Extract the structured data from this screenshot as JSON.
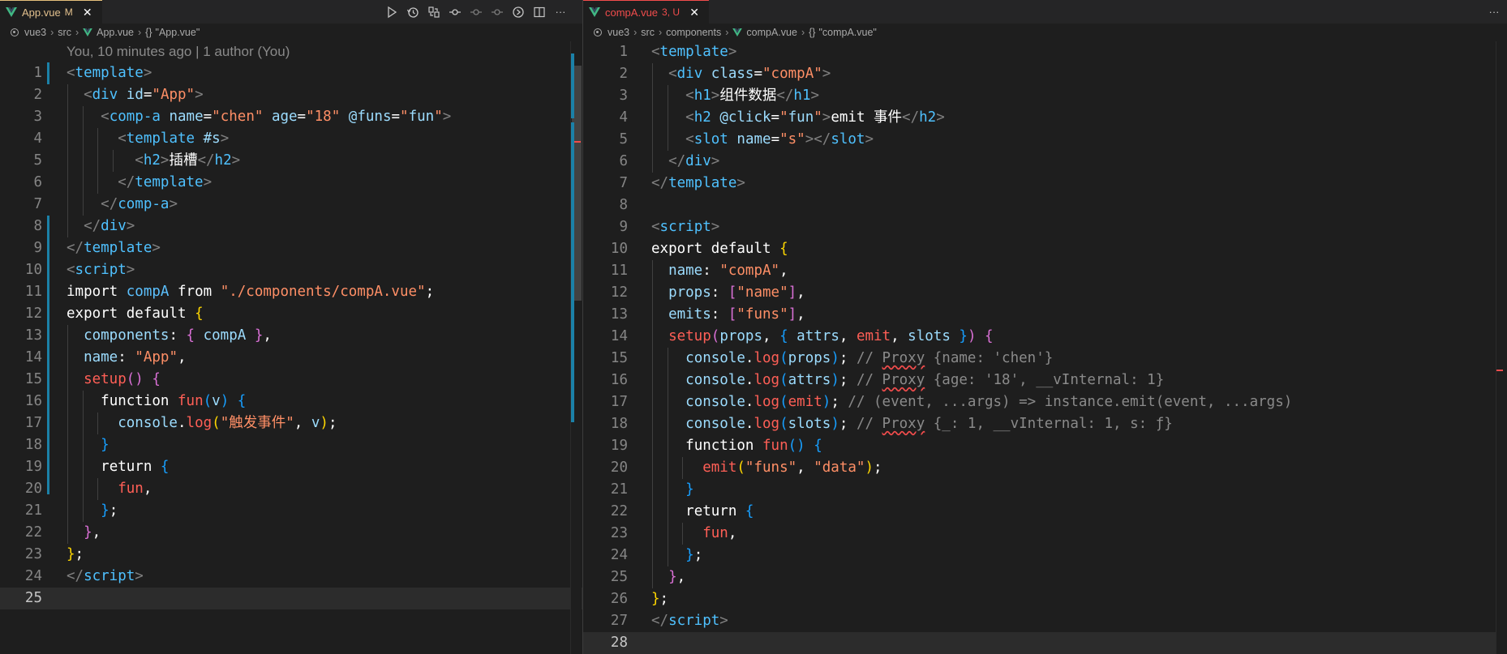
{
  "left_editor": {
    "tab": {
      "filename": "App.vue",
      "status": "M"
    },
    "toolbar_icons": [
      "run-icon",
      "history-icon",
      "compare-changes-icon",
      "git-commit-icon",
      "previous-change-icon",
      "next-change-icon",
      "open-timeline-icon",
      "split-editor-icon",
      "more-actions-icon"
    ],
    "more_label": "···",
    "breadcrumb": [
      "vue3",
      "src",
      "App.vue",
      "\"App.vue\""
    ],
    "blame": "You, 10 minutes ago | 1 author (You)",
    "current_line": 25,
    "lines": [
      [
        [
          "t-br",
          "<"
        ],
        [
          "t-tag",
          "template"
        ],
        [
          "t-br",
          ">"
        ]
      ],
      [
        [
          "t-plain",
          "  "
        ],
        [
          "t-br",
          "<"
        ],
        [
          "t-tag",
          "div"
        ],
        [
          "t-plain",
          " "
        ],
        [
          "t-attr",
          "id"
        ],
        [
          "t-white",
          "="
        ],
        [
          "t-str",
          "\"App\""
        ],
        [
          "t-br",
          ">"
        ]
      ],
      [
        [
          "t-plain",
          "    "
        ],
        [
          "t-br",
          "<"
        ],
        [
          "t-tag",
          "comp-a"
        ],
        [
          "t-plain",
          " "
        ],
        [
          "t-attr",
          "name"
        ],
        [
          "t-white",
          "="
        ],
        [
          "t-str",
          "\"chen\""
        ],
        [
          "t-plain",
          " "
        ],
        [
          "t-attr",
          "age"
        ],
        [
          "t-white",
          "="
        ],
        [
          "t-str",
          "\"18\""
        ],
        [
          "t-plain",
          " "
        ],
        [
          "t-attr",
          "@funs"
        ],
        [
          "t-white",
          "="
        ],
        [
          "t-str",
          "\""
        ],
        [
          "t-attr",
          "fun"
        ],
        [
          "t-str",
          "\""
        ],
        [
          "t-br",
          ">"
        ]
      ],
      [
        [
          "t-plain",
          "      "
        ],
        [
          "t-br",
          "<"
        ],
        [
          "t-tag",
          "template"
        ],
        [
          "t-plain",
          " "
        ],
        [
          "t-attr",
          "#s"
        ],
        [
          "t-br",
          ">"
        ]
      ],
      [
        [
          "t-plain",
          "        "
        ],
        [
          "t-br",
          "<"
        ],
        [
          "t-tag",
          "h2"
        ],
        [
          "t-br",
          ">"
        ],
        [
          "t-white",
          "插槽"
        ],
        [
          "t-br",
          "</"
        ],
        [
          "t-tag",
          "h2"
        ],
        [
          "t-br",
          ">"
        ]
      ],
      [
        [
          "t-plain",
          "      "
        ],
        [
          "t-br",
          "</"
        ],
        [
          "t-tag",
          "template"
        ],
        [
          "t-br",
          ">"
        ]
      ],
      [
        [
          "t-plain",
          "    "
        ],
        [
          "t-br",
          "</"
        ],
        [
          "t-tag",
          "comp-a"
        ],
        [
          "t-br",
          ">"
        ]
      ],
      [
        [
          "t-plain",
          "  "
        ],
        [
          "t-br",
          "</"
        ],
        [
          "t-tag",
          "div"
        ],
        [
          "t-br",
          ">"
        ]
      ],
      [
        [
          "t-br",
          "</"
        ],
        [
          "t-tag",
          "template"
        ],
        [
          "t-br",
          ">"
        ]
      ],
      [
        [
          "t-br",
          "<"
        ],
        [
          "t-tag",
          "script"
        ],
        [
          "t-br",
          ">"
        ]
      ],
      [
        [
          "t-kw",
          "import"
        ],
        [
          "t-plain",
          " "
        ],
        [
          "t-var",
          "compA"
        ],
        [
          "t-plain",
          " "
        ],
        [
          "t-kw",
          "from"
        ],
        [
          "t-plain",
          " "
        ],
        [
          "t-str",
          "\"./components/compA.vue\""
        ],
        [
          "t-white",
          ";"
        ]
      ],
      [
        [
          "t-kw",
          "export"
        ],
        [
          "t-plain",
          " "
        ],
        [
          "t-kw",
          "default"
        ],
        [
          "t-plain",
          " "
        ],
        [
          "t-p1",
          "{"
        ]
      ],
      [
        [
          "t-plain",
          "  "
        ],
        [
          "t-attr",
          "components"
        ],
        [
          "t-white",
          ": "
        ],
        [
          "t-p2",
          "{"
        ],
        [
          "t-plain",
          " "
        ],
        [
          "t-attr",
          "compA"
        ],
        [
          "t-plain",
          " "
        ],
        [
          "t-p2",
          "}"
        ],
        [
          "t-white",
          ","
        ]
      ],
      [
        [
          "t-plain",
          "  "
        ],
        [
          "t-attr",
          "name"
        ],
        [
          "t-white",
          ": "
        ],
        [
          "t-str",
          "\"App\""
        ],
        [
          "t-white",
          ","
        ]
      ],
      [
        [
          "t-plain",
          "  "
        ],
        [
          "t-fn",
          "setup"
        ],
        [
          "t-p2",
          "()"
        ],
        [
          "t-plain",
          " "
        ],
        [
          "t-p2",
          "{"
        ]
      ],
      [
        [
          "t-plain",
          "    "
        ],
        [
          "t-kw",
          "function"
        ],
        [
          "t-plain",
          " "
        ],
        [
          "t-fn",
          "fun"
        ],
        [
          "t-p3",
          "("
        ],
        [
          "t-attr",
          "v"
        ],
        [
          "t-p3",
          ")"
        ],
        [
          "t-plain",
          " "
        ],
        [
          "t-p3",
          "{"
        ]
      ],
      [
        [
          "t-plain",
          "      "
        ],
        [
          "t-attr",
          "console"
        ],
        [
          "t-white",
          "."
        ],
        [
          "t-fn",
          "log"
        ],
        [
          "t-p1",
          "("
        ],
        [
          "t-str",
          "\"触发事件\""
        ],
        [
          "t-white",
          ", "
        ],
        [
          "t-attr",
          "v"
        ],
        [
          "t-p1",
          ")"
        ],
        [
          "t-white",
          ";"
        ]
      ],
      [
        [
          "t-plain",
          "    "
        ],
        [
          "t-p3",
          "}"
        ]
      ],
      [
        [
          "t-plain",
          "    "
        ],
        [
          "t-kw",
          "return"
        ],
        [
          "t-plain",
          " "
        ],
        [
          "t-p3",
          "{"
        ]
      ],
      [
        [
          "t-plain",
          "      "
        ],
        [
          "t-fn",
          "fun"
        ],
        [
          "t-white",
          ","
        ]
      ],
      [
        [
          "t-plain",
          "    "
        ],
        [
          "t-p3",
          "}"
        ],
        [
          "t-white",
          ";"
        ]
      ],
      [
        [
          "t-plain",
          "  "
        ],
        [
          "t-p2",
          "}"
        ],
        [
          "t-white",
          ","
        ]
      ],
      [
        [
          "t-p1",
          "}"
        ],
        [
          "t-white",
          ";"
        ]
      ],
      [
        [
          "t-br",
          "</"
        ],
        [
          "t-tag",
          "script"
        ],
        [
          "t-br",
          ">"
        ]
      ],
      []
    ]
  },
  "right_editor": {
    "tab": {
      "filename": "compA.vue",
      "status": "3, U"
    },
    "more_label": "···",
    "breadcrumb": [
      "vue3",
      "src",
      "components",
      "compA.vue",
      "\"compA.vue\""
    ],
    "current_line": 28,
    "lines": [
      [
        [
          "t-br",
          "<"
        ],
        [
          "t-tag",
          "template"
        ],
        [
          "t-br",
          ">"
        ]
      ],
      [
        [
          "t-plain",
          "  "
        ],
        [
          "t-br",
          "<"
        ],
        [
          "t-tag",
          "div"
        ],
        [
          "t-plain",
          " "
        ],
        [
          "t-attr",
          "class"
        ],
        [
          "t-white",
          "="
        ],
        [
          "t-str",
          "\"compA\""
        ],
        [
          "t-br",
          ">"
        ]
      ],
      [
        [
          "t-plain",
          "    "
        ],
        [
          "t-br",
          "<"
        ],
        [
          "t-tag",
          "h1"
        ],
        [
          "t-br",
          ">"
        ],
        [
          "t-white",
          "组件数据"
        ],
        [
          "t-br",
          "</"
        ],
        [
          "t-tag",
          "h1"
        ],
        [
          "t-br",
          ">"
        ]
      ],
      [
        [
          "t-plain",
          "    "
        ],
        [
          "t-br",
          "<"
        ],
        [
          "t-tag",
          "h2"
        ],
        [
          "t-plain",
          " "
        ],
        [
          "t-attr",
          "@click"
        ],
        [
          "t-white",
          "="
        ],
        [
          "t-str",
          "\""
        ],
        [
          "t-attr",
          "fun"
        ],
        [
          "t-str",
          "\""
        ],
        [
          "t-br",
          ">"
        ],
        [
          "t-white",
          "emit 事件"
        ],
        [
          "t-br",
          "</"
        ],
        [
          "t-tag",
          "h2"
        ],
        [
          "t-br",
          ">"
        ]
      ],
      [
        [
          "t-plain",
          "    "
        ],
        [
          "t-br",
          "<"
        ],
        [
          "t-tag",
          "slot"
        ],
        [
          "t-plain",
          " "
        ],
        [
          "t-attr",
          "name"
        ],
        [
          "t-white",
          "="
        ],
        [
          "t-str",
          "\"s\""
        ],
        [
          "t-br",
          "></"
        ],
        [
          "t-tag",
          "slot"
        ],
        [
          "t-br",
          ">"
        ]
      ],
      [
        [
          "t-plain",
          "  "
        ],
        [
          "t-br",
          "</"
        ],
        [
          "t-tag",
          "div"
        ],
        [
          "t-br",
          ">"
        ]
      ],
      [
        [
          "t-br",
          "</"
        ],
        [
          "t-tag",
          "template"
        ],
        [
          "t-br",
          ">"
        ]
      ],
      [],
      [
        [
          "t-br",
          "<"
        ],
        [
          "t-tag",
          "script"
        ],
        [
          "t-br",
          ">"
        ]
      ],
      [
        [
          "t-kw",
          "export"
        ],
        [
          "t-plain",
          " "
        ],
        [
          "t-kw",
          "default"
        ],
        [
          "t-plain",
          " "
        ],
        [
          "t-p1",
          "{"
        ]
      ],
      [
        [
          "t-plain",
          "  "
        ],
        [
          "t-attr",
          "name"
        ],
        [
          "t-white",
          ": "
        ],
        [
          "t-str",
          "\"compA\""
        ],
        [
          "t-white",
          ","
        ]
      ],
      [
        [
          "t-plain",
          "  "
        ],
        [
          "t-attr",
          "props"
        ],
        [
          "t-white",
          ": "
        ],
        [
          "t-p2",
          "["
        ],
        [
          "t-str",
          "\"name\""
        ],
        [
          "t-p2",
          "]"
        ],
        [
          "t-white",
          ","
        ]
      ],
      [
        [
          "t-plain",
          "  "
        ],
        [
          "t-attr",
          "emits"
        ],
        [
          "t-white",
          ": "
        ],
        [
          "t-p2",
          "["
        ],
        [
          "t-str",
          "\"funs\""
        ],
        [
          "t-p2",
          "]"
        ],
        [
          "t-white",
          ","
        ]
      ],
      [
        [
          "t-plain",
          "  "
        ],
        [
          "t-fn",
          "setup"
        ],
        [
          "t-p2",
          "("
        ],
        [
          "t-attr",
          "props"
        ],
        [
          "t-white",
          ", "
        ],
        [
          "t-p3",
          "{"
        ],
        [
          "t-plain",
          " "
        ],
        [
          "t-attr",
          "attrs"
        ],
        [
          "t-white",
          ", "
        ],
        [
          "t-fn",
          "emit"
        ],
        [
          "t-white",
          ", "
        ],
        [
          "t-attr",
          "slots"
        ],
        [
          "t-plain",
          " "
        ],
        [
          "t-p3",
          "}"
        ],
        [
          "t-p2",
          ")"
        ],
        [
          "t-plain",
          " "
        ],
        [
          "t-p2",
          "{"
        ]
      ],
      [
        [
          "t-plain",
          "    "
        ],
        [
          "t-attr",
          "console"
        ],
        [
          "t-white",
          "."
        ],
        [
          "t-fn",
          "log"
        ],
        [
          "t-p3",
          "("
        ],
        [
          "t-attr",
          "props"
        ],
        [
          "t-p3",
          ")"
        ],
        [
          "t-white",
          "; "
        ],
        [
          "t-com",
          "// "
        ],
        [
          "t-com squig",
          "Proxy"
        ],
        [
          "t-com",
          " {name: 'chen'}"
        ]
      ],
      [
        [
          "t-plain",
          "    "
        ],
        [
          "t-attr",
          "console"
        ],
        [
          "t-white",
          "."
        ],
        [
          "t-fn",
          "log"
        ],
        [
          "t-p3",
          "("
        ],
        [
          "t-attr",
          "attrs"
        ],
        [
          "t-p3",
          ")"
        ],
        [
          "t-white",
          "; "
        ],
        [
          "t-com",
          "// "
        ],
        [
          "t-com squig",
          "Proxy"
        ],
        [
          "t-com",
          " {age: '18', __vInternal: 1}"
        ]
      ],
      [
        [
          "t-plain",
          "    "
        ],
        [
          "t-attr",
          "console"
        ],
        [
          "t-white",
          "."
        ],
        [
          "t-fn",
          "log"
        ],
        [
          "t-p3",
          "("
        ],
        [
          "t-fn",
          "emit"
        ],
        [
          "t-p3",
          ")"
        ],
        [
          "t-white",
          "; "
        ],
        [
          "t-com",
          "// (event, ...args) => instance.emit(event, ...args)"
        ]
      ],
      [
        [
          "t-plain",
          "    "
        ],
        [
          "t-attr",
          "console"
        ],
        [
          "t-white",
          "."
        ],
        [
          "t-fn",
          "log"
        ],
        [
          "t-p3",
          "("
        ],
        [
          "t-attr",
          "slots"
        ],
        [
          "t-p3",
          ")"
        ],
        [
          "t-white",
          "; "
        ],
        [
          "t-com",
          "// "
        ],
        [
          "t-com squig",
          "Proxy"
        ],
        [
          "t-com",
          " {_: 1, __vInternal: 1, s: ƒ}"
        ]
      ],
      [
        [
          "t-plain",
          "    "
        ],
        [
          "t-kw",
          "function"
        ],
        [
          "t-plain",
          " "
        ],
        [
          "t-fn",
          "fun"
        ],
        [
          "t-p3",
          "()"
        ],
        [
          "t-plain",
          " "
        ],
        [
          "t-p3",
          "{"
        ]
      ],
      [
        [
          "t-plain",
          "      "
        ],
        [
          "t-fn",
          "emit"
        ],
        [
          "t-p1",
          "("
        ],
        [
          "t-str",
          "\"funs\""
        ],
        [
          "t-white",
          ", "
        ],
        [
          "t-str",
          "\"data\""
        ],
        [
          "t-p1",
          ")"
        ],
        [
          "t-white",
          ";"
        ]
      ],
      [
        [
          "t-plain",
          "    "
        ],
        [
          "t-p3",
          "}"
        ]
      ],
      [
        [
          "t-plain",
          "    "
        ],
        [
          "t-kw",
          "return"
        ],
        [
          "t-plain",
          " "
        ],
        [
          "t-p3",
          "{"
        ]
      ],
      [
        [
          "t-plain",
          "      "
        ],
        [
          "t-fn",
          "fun"
        ],
        [
          "t-white",
          ","
        ]
      ],
      [
        [
          "t-plain",
          "    "
        ],
        [
          "t-p3",
          "}"
        ],
        [
          "t-white",
          ";"
        ]
      ],
      [
        [
          "t-plain",
          "  "
        ],
        [
          "t-p2",
          "}"
        ],
        [
          "t-white",
          ","
        ]
      ],
      [
        [
          "t-p1",
          "}"
        ],
        [
          "t-white",
          ";"
        ]
      ],
      [
        [
          "t-br",
          "</"
        ],
        [
          "t-tag",
          "script"
        ],
        [
          "t-br",
          ">"
        ]
      ],
      []
    ]
  },
  "colors": {
    "accent_blue": "#1b81a8",
    "modified": "#e2c08d",
    "error": "#f14c4c"
  }
}
